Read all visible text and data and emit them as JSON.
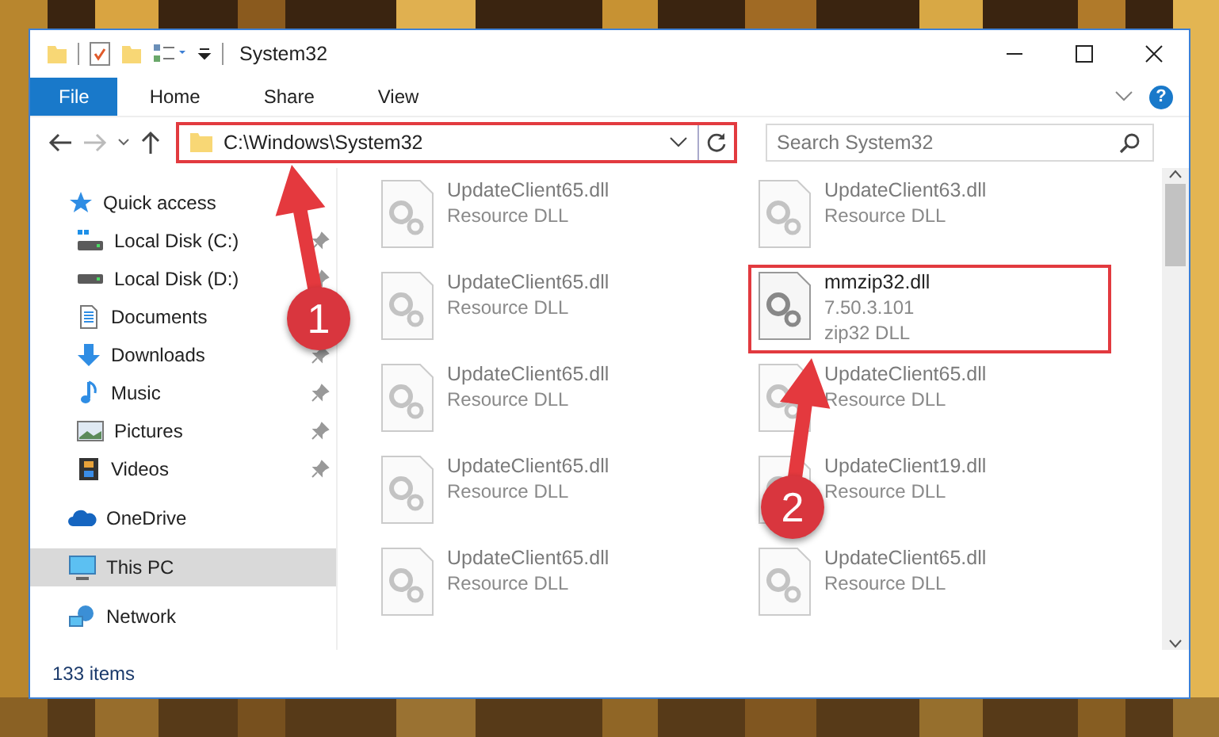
{
  "window": {
    "title": "System32"
  },
  "ribbon_tabs": [
    {
      "label": "File",
      "kind": "file"
    },
    {
      "label": "Home",
      "kind": "tab"
    },
    {
      "label": "Share",
      "kind": "tab"
    },
    {
      "label": "View",
      "kind": "tab"
    }
  ],
  "help": "?",
  "nav": {
    "forward_disabled": true
  },
  "address": {
    "path": "C:\\Windows\\System32",
    "highlighted": true
  },
  "search": {
    "placeholder": "Search System32"
  },
  "sidebar": {
    "items": [
      {
        "label": "Quick access",
        "kind": "star",
        "selected": false,
        "children": [
          {
            "label": "Local Disk (C:)",
            "kind": "system-drive",
            "pinned": true,
            "selected": false
          },
          {
            "label": "Local Disk (D:)",
            "kind": "drive",
            "pinned": true,
            "selected": false
          },
          {
            "label": "Documents",
            "kind": "documents",
            "selected": false
          },
          {
            "label": "Downloads",
            "kind": "downloads",
            "pinned": true,
            "selected": false
          },
          {
            "label": "Music",
            "kind": "music",
            "pinned": true,
            "selected": false
          },
          {
            "label": "Pictures",
            "kind": "pictures",
            "pinned": true,
            "selected": false
          },
          {
            "label": "Videos",
            "kind": "videos",
            "pinned": true,
            "selected": false
          }
        ]
      },
      {
        "label": "OneDrive",
        "kind": "cloud",
        "selected": false
      },
      {
        "label": "This PC",
        "kind": "computer",
        "selected": true
      },
      {
        "label": "Network",
        "kind": "network",
        "selected": false
      }
    ]
  },
  "files": [
    {
      "name": "UpdateClient65.dll",
      "details": [
        "Resource DLL"
      ],
      "blurred": true,
      "highlighted": false
    },
    {
      "name": "UpdateClient63.dll",
      "details": [
        "Resource DLL"
      ],
      "blurred": true,
      "highlighted": false
    },
    {
      "name": "UpdateClient65.dll",
      "details": [
        "Resource DLL"
      ],
      "blurred": true,
      "highlighted": false
    },
    {
      "name": "mmzip32.dll",
      "details": [
        "7.50.3.101",
        "zip32 DLL"
      ],
      "blurred": false,
      "highlighted": true
    },
    {
      "name": "UpdateClient65.dll",
      "details": [
        "Resource DLL"
      ],
      "blurred": true,
      "highlighted": false
    },
    {
      "name": "UpdateClient65.dll",
      "details": [
        "Resource DLL"
      ],
      "blurred": true,
      "highlighted": false
    },
    {
      "name": "UpdateClient65.dll",
      "details": [
        "Resource DLL"
      ],
      "blurred": true,
      "highlighted": false
    },
    {
      "name": "UpdateClient19.dll",
      "details": [
        "Resource DLL"
      ],
      "blurred": true,
      "highlighted": false
    },
    {
      "name": "UpdateClient65.dll",
      "details": [
        "Resource DLL"
      ],
      "blurred": true,
      "highlighted": false
    },
    {
      "name": "UpdateClient65.dll",
      "details": [
        "Resource DLL"
      ],
      "blurred": true,
      "highlighted": false
    }
  ],
  "status_bar": {
    "item_count": "133 items"
  },
  "annotations": [
    {
      "number": "1"
    },
    {
      "number": "2"
    }
  ]
}
